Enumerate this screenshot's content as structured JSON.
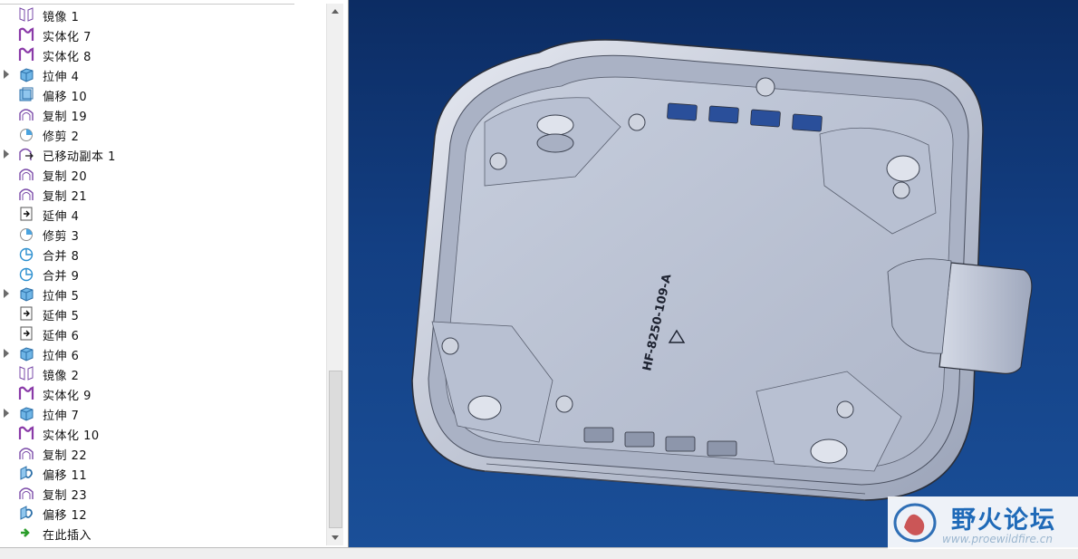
{
  "tree": {
    "items": [
      {
        "label": "镜像 1",
        "icon": "mirror-icon",
        "expandable": false
      },
      {
        "label": "实体化 7",
        "icon": "solidify-icon",
        "expandable": false
      },
      {
        "label": "实体化 8",
        "icon": "solidify-icon",
        "expandable": false
      },
      {
        "label": "拉伸 4",
        "icon": "extrude-icon",
        "expandable": true
      },
      {
        "label": "偏移 10",
        "icon": "offset-icon",
        "expandable": false
      },
      {
        "label": "复制 19",
        "icon": "copy-icon",
        "expandable": false
      },
      {
        "label": "修剪 2",
        "icon": "trim-icon",
        "expandable": false
      },
      {
        "label": "已移动副本 1",
        "icon": "moved-copy-icon",
        "expandable": true
      },
      {
        "label": "复制 20",
        "icon": "copy-icon",
        "expandable": false
      },
      {
        "label": "复制 21",
        "icon": "copy-icon",
        "expandable": false
      },
      {
        "label": "延伸 4",
        "icon": "extend-icon",
        "expandable": false
      },
      {
        "label": "修剪 3",
        "icon": "trim-icon",
        "expandable": false
      },
      {
        "label": "合并 8",
        "icon": "merge-icon",
        "expandable": false
      },
      {
        "label": "合并 9",
        "icon": "merge-icon",
        "expandable": false
      },
      {
        "label": "拉伸 5",
        "icon": "extrude-icon",
        "expandable": true
      },
      {
        "label": "延伸 5",
        "icon": "extend-icon",
        "expandable": false
      },
      {
        "label": "延伸 6",
        "icon": "extend-icon",
        "expandable": false
      },
      {
        "label": "拉伸 6",
        "icon": "extrude-icon",
        "expandable": true
      },
      {
        "label": "镜像 2",
        "icon": "mirror-icon",
        "expandable": false
      },
      {
        "label": "实体化 9",
        "icon": "solidify-icon",
        "expandable": false
      },
      {
        "label": "拉伸 7",
        "icon": "extrude-icon",
        "expandable": true
      },
      {
        "label": "实体化 10",
        "icon": "solidify-icon",
        "expandable": false
      },
      {
        "label": "复制 22",
        "icon": "copy-icon",
        "expandable": false
      },
      {
        "label": "偏移 11",
        "icon": "offset-surface-icon",
        "expandable": false
      },
      {
        "label": "复制 23",
        "icon": "copy-icon",
        "expandable": false
      },
      {
        "label": "偏移 12",
        "icon": "offset-surface-icon",
        "expandable": false
      },
      {
        "label": "在此插入",
        "icon": "insert-here-arrow-icon",
        "expandable": false
      }
    ]
  },
  "model": {
    "part_marking": "HF-8250-109-A"
  },
  "watermark": {
    "title": "野火论坛",
    "url": "www.proewildfire.cn"
  },
  "colors": {
    "viewport_top": "#0c2c63",
    "viewport_bottom": "#1a4f98",
    "part_face": "#bcc4d6",
    "insert_arrow": "#2a9d2a",
    "watermark_title": "#1f6ab8"
  }
}
